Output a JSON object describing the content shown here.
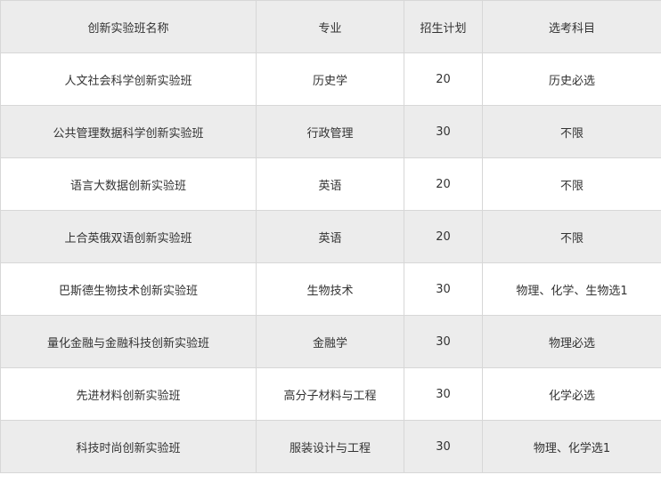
{
  "table": {
    "headers": [
      "创新实验班名称",
      "专业",
      "招生计划",
      "选考科目"
    ],
    "rows": [
      [
        "人文社会科学创新实验班",
        "历史学",
        "20",
        "历史必选"
      ],
      [
        "公共管理数据科学创新实验班",
        "行政管理",
        "30",
        "不限"
      ],
      [
        "语言大数据创新实验班",
        "英语",
        "20",
        "不限"
      ],
      [
        "上合英俄双语创新实验班",
        "英语",
        "20",
        "不限"
      ],
      [
        "巴斯德生物技术创新实验班",
        "生物技术",
        "30",
        "物理、化学、生物选1"
      ],
      [
        "量化金融与金融科技创新实验班",
        "金融学",
        "30",
        "物理必选"
      ],
      [
        "先进材料创新实验班",
        "高分子材料与工程",
        "30",
        "化学必选"
      ],
      [
        "科技时尚创新实验班",
        "服装设计与工程",
        "30",
        "物理、化学选1"
      ]
    ]
  }
}
